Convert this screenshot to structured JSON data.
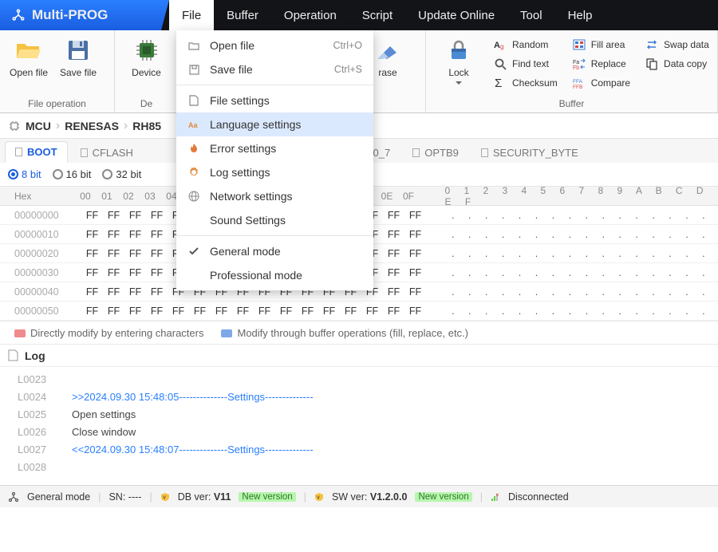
{
  "app_title": "Multi-PROG",
  "menubar": [
    "File",
    "Buffer",
    "Operation",
    "Script",
    "Update Online",
    "Tool",
    "Help"
  ],
  "menubar_active": 0,
  "ribbon": {
    "file_op_label": "File operation",
    "open_file": "Open file",
    "save_file": "Save file",
    "device": "Device",
    "device_group_label": "De",
    "erase": "rase",
    "lock": "Lock",
    "random": "Random",
    "find_text": "Find text",
    "checksum": "Checksum",
    "fill_area": "Fill area",
    "replace": "Replace",
    "compare": "Compare",
    "swap_data": "Swap data",
    "data_copy": "Data copy",
    "buffer_label": "Buffer"
  },
  "crumbs": [
    "MCU",
    "RENESAS",
    "RH85"
  ],
  "tabs": [
    "BOOT",
    "CFLASH",
    "",
    "B0_7",
    "OPTB9",
    "SECURITY_BYTE"
  ],
  "tab_active": 0,
  "bits": {
    "b8": "8 bit",
    "b16": "16 bit",
    "b32": "32 bit"
  },
  "goto_suffix": "to",
  "hex": {
    "hdr_label": "Hex",
    "cols": [
      "00",
      "01",
      "02",
      "03",
      "04",
      "05",
      "06",
      "07",
      "08",
      "09",
      "0A",
      "0B",
      "0C",
      "0D",
      "0E",
      "0F"
    ],
    "ascii_hdr": "0123456789ABCDEF",
    "rows": [
      {
        "addr": "00000000",
        "bytes": [
          "FF",
          "FF",
          "FF",
          "FF",
          "FF",
          "FF",
          "FF",
          "FF",
          "FF",
          "FF",
          "FF",
          "FF",
          "FF",
          "FF",
          "FF",
          "FF"
        ],
        "ascii": "................"
      },
      {
        "addr": "00000010",
        "bytes": [
          "FF",
          "FF",
          "FF",
          "FF",
          "FF",
          "FF",
          "FF",
          "FF",
          "FF",
          "FF",
          "FF",
          "FF",
          "FF",
          "FF",
          "FF",
          "FF"
        ],
        "ascii": "................"
      },
      {
        "addr": "00000020",
        "bytes": [
          "FF",
          "FF",
          "FF",
          "FF",
          "FF",
          "FF",
          "FF",
          "FF",
          "FF",
          "FF",
          "FF",
          "FF",
          "FF",
          "FF",
          "FF",
          "FF"
        ],
        "ascii": "................"
      },
      {
        "addr": "00000030",
        "bytes": [
          "FF",
          "FF",
          "FF",
          "FF",
          "FF",
          "FF",
          "FF",
          "FF",
          "FF",
          "FF",
          "FF",
          "FF",
          "FF",
          "FF",
          "FF",
          "FF"
        ],
        "ascii": "................"
      },
      {
        "addr": "00000040",
        "bytes": [
          "FF",
          "FF",
          "FF",
          "FF",
          "FF",
          "FF",
          "FF",
          "FF",
          "FF",
          "FF",
          "FF",
          "FF",
          "FF",
          "FF",
          "FF",
          "FF"
        ],
        "ascii": "................"
      },
      {
        "addr": "00000050",
        "bytes": [
          "FF",
          "FF",
          "FF",
          "FF",
          "FF",
          "FF",
          "FF",
          "FF",
          "FF",
          "FF",
          "FF",
          "FF",
          "FF",
          "FF",
          "FF",
          "FF"
        ],
        "ascii": "................"
      }
    ]
  },
  "legend": {
    "red": "Directly modify by entering characters",
    "blue": "Modify through buffer operations (fill, replace, etc.)"
  },
  "log": {
    "title": "Log",
    "rows": [
      {
        "ln": "L0023",
        "msg": "",
        "blue": false
      },
      {
        "ln": "L0024",
        "msg": ">>2024.09.30 15:48:05--------------Settings--------------",
        "blue": true
      },
      {
        "ln": "L0025",
        "msg": "Open settings",
        "blue": false
      },
      {
        "ln": "L0026",
        "msg": "Close window",
        "blue": false
      },
      {
        "ln": "L0027",
        "msg": "<<2024.09.30 15:48:07--------------Settings--------------",
        "blue": true
      },
      {
        "ln": "L0028",
        "msg": "",
        "blue": false
      }
    ]
  },
  "status": {
    "mode": "General mode",
    "sn": "SN:  ----",
    "db_label": "DB ver: ",
    "db_ver": "V11",
    "new_version": "New version",
    "sw_label": "SW ver: ",
    "sw_ver": "V1.2.0.0",
    "disconnected": "Disconnected"
  },
  "dropdown": {
    "open": {
      "label": "Open file",
      "sc": "Ctrl+O"
    },
    "save": {
      "label": "Save file",
      "sc": "Ctrl+S"
    },
    "file_settings": "File settings",
    "lang_settings": "Language settings",
    "error_settings": "Error settings",
    "log_settings": "Log settings",
    "network_settings": "Network settings",
    "sound_settings": "Sound Settings",
    "general_mode": "General mode",
    "professional_mode": "Professional mode"
  }
}
